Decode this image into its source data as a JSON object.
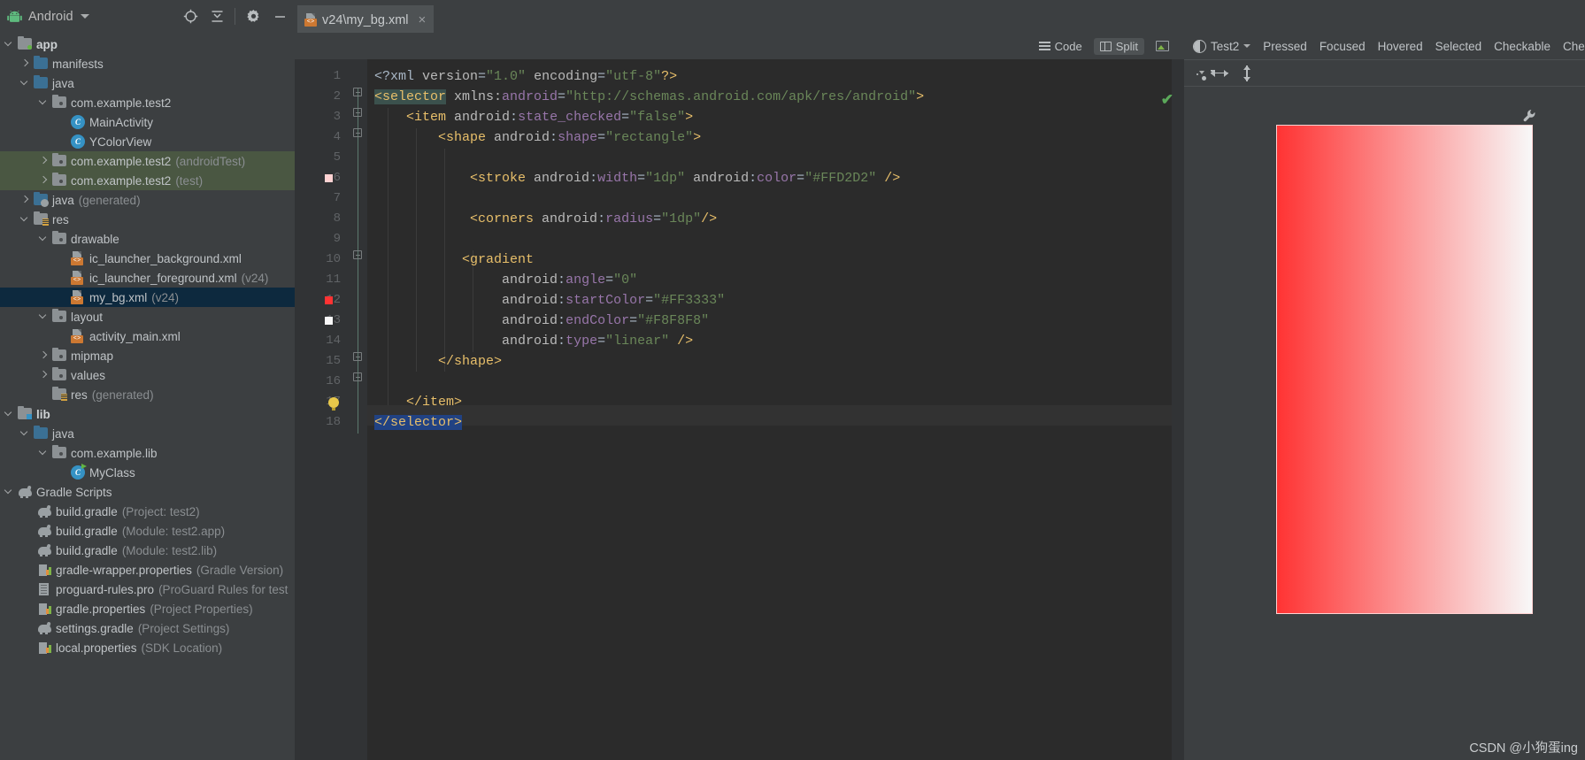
{
  "window": {
    "project_panel_title": "Android",
    "watermark": "CSDN @小狗蛋ing"
  },
  "panel_toolbar": {
    "icons": [
      {
        "name": "locate-icon",
        "glyph": "◎"
      },
      {
        "name": "collapse-all-icon",
        "glyph": "⇤"
      },
      {
        "name": "settings-gear-icon",
        "glyph": "⚙"
      },
      {
        "name": "hide-panel-icon",
        "glyph": "—"
      }
    ]
  },
  "editor_tabs": [
    {
      "label": "v24\\my_bg.xml",
      "icon": "xml-file-icon",
      "close": "×",
      "active": true
    }
  ],
  "view_modes": {
    "code_label": "Code",
    "split_label": "Split",
    "design_icon": "design-image-icon",
    "active": "Split"
  },
  "tree": [
    {
      "depth": 0,
      "arrow": "open",
      "icon": "folder-gray-green",
      "label": "app",
      "bold": true,
      "sub": ""
    },
    {
      "depth": 1,
      "arrow": "closed",
      "icon": "folder-blue",
      "label": "manifests",
      "sub": ""
    },
    {
      "depth": 1,
      "arrow": "open",
      "icon": "folder-blue",
      "label": "java",
      "sub": ""
    },
    {
      "depth": 2,
      "arrow": "open",
      "icon": "package",
      "label": "com.example.test2",
      "sub": ""
    },
    {
      "depth": 3,
      "arrow": "none",
      "icon": "class",
      "label": "MainActivity",
      "sub": ""
    },
    {
      "depth": 3,
      "arrow": "none",
      "icon": "class",
      "label": "YColorView",
      "sub": ""
    },
    {
      "depth": 2,
      "arrow": "closed",
      "icon": "package",
      "label": "com.example.test2",
      "sub": "(androidTest)",
      "group": true
    },
    {
      "depth": 2,
      "arrow": "closed",
      "icon": "package",
      "label": "com.example.test2",
      "sub": "(test)",
      "group": true
    },
    {
      "depth": 1,
      "arrow": "closed",
      "icon": "folder-generated",
      "label": "java",
      "sub": "(generated)"
    },
    {
      "depth": 1,
      "arrow": "open",
      "icon": "folder-res",
      "label": "res",
      "sub": ""
    },
    {
      "depth": 2,
      "arrow": "open",
      "icon": "package",
      "label": "drawable",
      "sub": ""
    },
    {
      "depth": 3,
      "arrow": "none",
      "icon": "xml-file",
      "label": "ic_launcher_background.xml",
      "sub": ""
    },
    {
      "depth": 3,
      "arrow": "none",
      "icon": "xml-file",
      "label": "ic_launcher_foreground.xml",
      "sub": "(v24)"
    },
    {
      "depth": 3,
      "arrow": "none",
      "icon": "xml-file",
      "label": "my_bg.xml",
      "sub": "(v24)",
      "selected": true
    },
    {
      "depth": 2,
      "arrow": "open",
      "icon": "package",
      "label": "layout",
      "sub": ""
    },
    {
      "depth": 3,
      "arrow": "none",
      "icon": "xml-file",
      "label": "activity_main.xml",
      "sub": ""
    },
    {
      "depth": 2,
      "arrow": "closed",
      "icon": "package",
      "label": "mipmap",
      "sub": ""
    },
    {
      "depth": 2,
      "arrow": "closed",
      "icon": "package",
      "label": "values",
      "sub": ""
    },
    {
      "depth": 1,
      "arrow": "none",
      "icon": "folder-res",
      "label": "res",
      "sub": "(generated)"
    },
    {
      "depth": 0,
      "arrow": "open",
      "icon": "folder-gray-blue",
      "label": "lib",
      "bold": true,
      "sub": ""
    },
    {
      "depth": 1,
      "arrow": "open",
      "icon": "folder-blue",
      "label": "java",
      "sub": ""
    },
    {
      "depth": 2,
      "arrow": "open",
      "icon": "package",
      "label": "com.example.lib",
      "sub": ""
    },
    {
      "depth": 3,
      "arrow": "none",
      "icon": "class-run",
      "label": "MyClass",
      "sub": ""
    },
    {
      "depth": 0,
      "arrow": "open",
      "icon": "gradle",
      "label": "Gradle Scripts",
      "sub": ""
    },
    {
      "depth": 1,
      "arrow": "none",
      "icon": "gradle",
      "label": "build.gradle",
      "sub": "(Project: test2)"
    },
    {
      "depth": 1,
      "arrow": "none",
      "icon": "gradle",
      "label": "build.gradle",
      "sub": "(Module: test2.app)"
    },
    {
      "depth": 1,
      "arrow": "none",
      "icon": "gradle",
      "label": "build.gradle",
      "sub": "(Module: test2.lib)"
    },
    {
      "depth": 1,
      "arrow": "none",
      "icon": "properties",
      "label": "gradle-wrapper.properties",
      "sub": "(Gradle Version)"
    },
    {
      "depth": 1,
      "arrow": "none",
      "icon": "doc",
      "label": "proguard-rules.pro",
      "sub": "(ProGuard Rules for test"
    },
    {
      "depth": 1,
      "arrow": "none",
      "icon": "properties",
      "label": "gradle.properties",
      "sub": "(Project Properties)"
    },
    {
      "depth": 1,
      "arrow": "none",
      "icon": "gradle",
      "label": "settings.gradle",
      "sub": "(Project Settings)"
    },
    {
      "depth": 1,
      "arrow": "none",
      "icon": "properties",
      "label": "local.properties",
      "sub": "(SDK Location)"
    }
  ],
  "code": {
    "inspection_status": "✔",
    "lines": [
      {
        "n": 1,
        "text": "<?xml version=\"1.0\" encoding=\"utf-8\"?>"
      },
      {
        "n": 2,
        "text": "<selector xmlns:android=\"http://schemas.android.com/apk/res/android\">"
      },
      {
        "n": 3,
        "text": "    <item android:state_checked=\"false\">"
      },
      {
        "n": 4,
        "text": "        <shape android:shape=\"rectangle\">"
      },
      {
        "n": 5,
        "text": ""
      },
      {
        "n": 6,
        "text": "            <stroke android:width=\"1dp\" android:color=\"#FFD2D2\" />",
        "gutter_color": "#FFD2D2"
      },
      {
        "n": 7,
        "text": ""
      },
      {
        "n": 8,
        "text": "            <corners android:radius=\"1dp\"/>"
      },
      {
        "n": 9,
        "text": ""
      },
      {
        "n": 10,
        "text": "           <gradient"
      },
      {
        "n": 11,
        "text": "                android:angle=\"0\""
      },
      {
        "n": 12,
        "text": "                android:startColor=\"#FF3333\"",
        "gutter_color": "#FF3333"
      },
      {
        "n": 13,
        "text": "                android:endColor=\"#F8F8F8\"",
        "gutter_color": "#F8F8F8"
      },
      {
        "n": 14,
        "text": "                android:type=\"linear\" />"
      },
      {
        "n": 15,
        "text": "        </shape>"
      },
      {
        "n": 16,
        "text": ""
      },
      {
        "n": 17,
        "text": "    </item>",
        "bulb": true
      },
      {
        "n": 18,
        "text": "</selector>",
        "cursor": true
      }
    ]
  },
  "preview": {
    "theme_label": "Test2",
    "states": [
      "Pressed",
      "Focused",
      "Hovered",
      "Selected",
      "Checkable",
      "Checked"
    ],
    "toolbar_icons": [
      "eye-visibility-icon",
      "horizontal-resize-icon",
      "vertical-resize-icon"
    ],
    "wrench_icon": "wrench-icon",
    "swatch": {
      "start_color": "#FF3333",
      "end_color": "#F8F8F8",
      "stroke_color": "#FFD2D2",
      "angle": "0",
      "type": "linear"
    }
  }
}
